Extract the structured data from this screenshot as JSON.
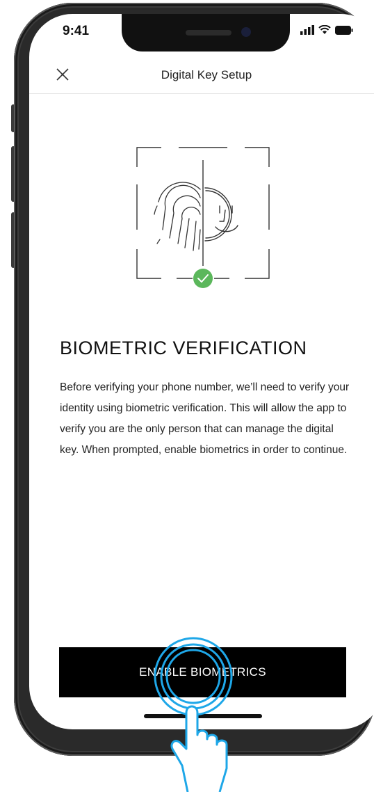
{
  "status_bar": {
    "time": "9:41"
  },
  "nav": {
    "title": "Digital Key Setup",
    "close_icon": "close-icon"
  },
  "content": {
    "heading": "BIOMETRIC VERIFICATION",
    "body": "Before verifying your phone number, we’ll need to verify your identity using biometric verification. This will allow the app to verify you are the only person that can manage the digital key. When prompted, enable biometrics in order to continue."
  },
  "actions": {
    "enable_label": "ENABLE BIOMETRICS"
  },
  "colors": {
    "accent_check": "#5bb75b",
    "button_bg": "#000000",
    "tap_highlight": "#1ea7e8"
  }
}
